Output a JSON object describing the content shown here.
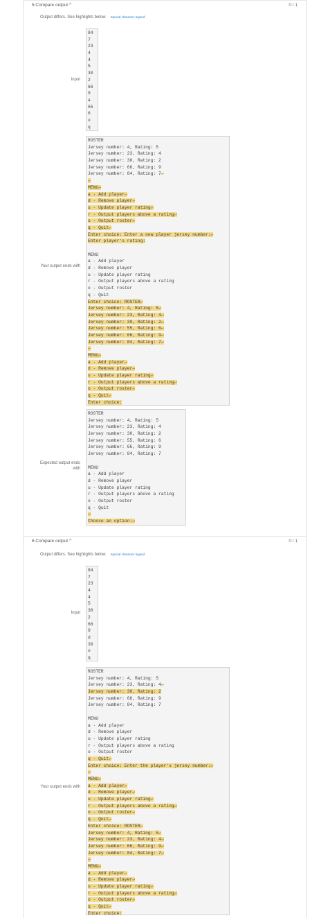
{
  "sections": [
    {
      "title": "5.Compare output",
      "score": "0 / 1",
      "summary": "Output differs. See highlights below.",
      "legend_link": "Special character legend",
      "input_label": "Input",
      "input_lines": [
        "84",
        "7",
        "23",
        "4",
        "4",
        "5",
        "30",
        "2",
        "66",
        "9",
        "a",
        "55",
        "6",
        "o",
        "q"
      ],
      "yours_label": "Your output ends with",
      "yours_lines": [
        {
          "t": "ROSTER"
        },
        {
          "t": "Jersey number: 4, Rating: 5"
        },
        {
          "t": "Jersey number: 23, Rating: 4"
        },
        {
          "t": "Jersey number: 30, Rating: 2"
        },
        {
          "t": "Jersey number: 66, Rating: 9"
        },
        {
          "t": "Jersey number: 84, Rating: 7",
          "nl": true
        },
        {
          "t": "",
          "nl": true,
          "hl": true
        },
        {
          "t": "MENU",
          "nl": true,
          "hl": true
        },
        {
          "t": "a - Add player",
          "nl": true,
          "hl": true
        },
        {
          "t": "d - Remove player",
          "nl": true,
          "hl": true
        },
        {
          "t": "u - Update player rating",
          "nl": true,
          "hl": true
        },
        {
          "t": "r - Output players above a rating",
          "nl": true,
          "hl": true
        },
        {
          "t": "o - Output roster",
          "nl": true,
          "hl": true
        },
        {
          "t": "q - Quit",
          "nl": true,
          "hl": true
        },
        {
          "t": "Enter choice: Enter a new player jersey number:",
          "nl": true,
          "hl": true
        },
        {
          "t": "Enter player's rating:",
          "hl": true
        },
        {
          "t": ""
        },
        {
          "t": "MENU"
        },
        {
          "t": "a - Add player"
        },
        {
          "t": "d - Remove player"
        },
        {
          "t": "u - Update player rating"
        },
        {
          "t": "r - Output players above a rating"
        },
        {
          "t": "o - Output roster"
        },
        {
          "t": "q - Quit"
        },
        {
          "t": "Enter choice: ROSTER",
          "nl": true,
          "hl": true
        },
        {
          "t": "Jersey number: 4, Rating: 5",
          "nl": true,
          "hl": true
        },
        {
          "t": "Jersey number: 23, Rating: 4",
          "nl": true,
          "hl": true
        },
        {
          "t": "Jersey number: 30, Rating: 2",
          "nl": true,
          "hl": true
        },
        {
          "t": "Jersey number: 55, Rating: 6",
          "nl": true,
          "hl": true
        },
        {
          "t": "Jersey number: 66, Rating: 9",
          "nl": true,
          "hl": true
        },
        {
          "t": "Jersey number: 84, Rating: 7",
          "nl": true,
          "hl": true
        },
        {
          "t": "",
          "nl": true,
          "hl": true
        },
        {
          "t": "MENU",
          "nl": true,
          "hl": true
        },
        {
          "t": "a - Add player",
          "nl": true,
          "hl": true
        },
        {
          "t": "d - Remove player",
          "nl": true,
          "hl": true
        },
        {
          "t": "u - Update player rating",
          "nl": true,
          "hl": true
        },
        {
          "t": "r - Output players above a rating",
          "nl": true,
          "hl": true
        },
        {
          "t": "o - Output roster",
          "nl": true,
          "hl": true
        },
        {
          "t": "q - Quit",
          "nl": true,
          "hl": true
        },
        {
          "t": "Enter choice:",
          "hl": true
        }
      ],
      "expected_label": "Expected output ends with",
      "expected_lines": [
        {
          "t": "ROSTER"
        },
        {
          "t": "Jersey number: 4, Rating: 5"
        },
        {
          "t": "Jersey number: 23, Rating: 4"
        },
        {
          "t": "Jersey number: 30, Rating: 2"
        },
        {
          "t": "Jersey number: 55, Rating: 6"
        },
        {
          "t": "Jersey number: 66, Rating: 9"
        },
        {
          "t": "Jersey number: 84, Rating: 7"
        },
        {
          "t": ""
        },
        {
          "t": "MENU"
        },
        {
          "t": "a - Add player"
        },
        {
          "t": "d - Remove player"
        },
        {
          "t": "u - Update player rating"
        },
        {
          "t": "r - Output players above a rating"
        },
        {
          "t": "o - Output roster"
        },
        {
          "t": "q - Quit"
        },
        {
          "t": "",
          "nl": true,
          "hl": true
        },
        {
          "t": "Choose an option:",
          "nl": true,
          "hl": true
        }
      ]
    },
    {
      "title": "6.Compare output",
      "score": "0 / 1",
      "summary": "Output differs. See highlights below.",
      "legend_link": "Special character legend",
      "input_label": "Input",
      "input_lines": [
        "84",
        "7",
        "23",
        "4",
        "4",
        "5",
        "30",
        "2",
        "66",
        "9",
        "d",
        "30",
        "o",
        "q"
      ],
      "yours_label": "Your output ends with",
      "yours_lines": [
        {
          "t": "ROSTER"
        },
        {
          "t": "Jersey number: 4, Rating: 5"
        },
        {
          "t": "Jersey number: 23, Rating: 4",
          "nl": true
        },
        {
          "t": "Jersey number: 30, Rating: 2",
          "hl": true
        },
        {
          "t": "Jersey number: 66, Rating: 9"
        },
        {
          "t": "Jersey number: 84, Rating: 7"
        },
        {
          "t": ""
        },
        {
          "t": "MENU"
        },
        {
          "t": "a - Add player"
        },
        {
          "t": "d - Remove player"
        },
        {
          "t": "u - Update player rating"
        },
        {
          "t": "r - Output players above a rating"
        },
        {
          "t": "o - Output roster"
        },
        {
          "t": "q - Quit",
          "nl": true,
          "hl": true
        },
        {
          "t": "Enter choice: Enter the player's jersey number:",
          "nl": true,
          "hl": true
        },
        {
          "t": "",
          "nl": true,
          "hl": true
        },
        {
          "t": "MENU",
          "nl": true,
          "hl": true
        },
        {
          "t": "a - Add player",
          "nl": true,
          "hl": true
        },
        {
          "t": "d - Remove player",
          "nl": true,
          "hl": true
        },
        {
          "t": "u - Update player rating",
          "nl": true,
          "hl": true
        },
        {
          "t": "r - Output players above a rating",
          "nl": true,
          "hl": true
        },
        {
          "t": "o - Output roster",
          "nl": true,
          "hl": true
        },
        {
          "t": "q - Quit",
          "nl": true,
          "hl": true
        },
        {
          "t": "Enter choice: ROSTER",
          "nl": true,
          "hl": true
        },
        {
          "t": "Jersey number: 4, Rating: 5",
          "nl": true,
          "hl": true
        },
        {
          "t": "Jersey number: 23, Rating: 4",
          "nl": true,
          "hl": true
        },
        {
          "t": "Jersey number: 66, Rating: 9",
          "nl": true,
          "hl": true
        },
        {
          "t": "Jersey number: 84, Rating: 7",
          "nl": true,
          "hl": true
        },
        {
          "t": "",
          "nl": true,
          "hl": true
        },
        {
          "t": "MENU",
          "nl": true,
          "hl": true
        },
        {
          "t": "a - Add player",
          "nl": true,
          "hl": true
        },
        {
          "t": "d - Remove player",
          "nl": true,
          "hl": true
        },
        {
          "t": "u - Update player rating",
          "nl": true,
          "hl": true
        },
        {
          "t": "r - Output players above a rating",
          "nl": true,
          "hl": true
        },
        {
          "t": "o - Output roster",
          "nl": true,
          "hl": true
        },
        {
          "t": "q - Quit",
          "nl": true,
          "hl": true
        },
        {
          "t": "Enter choice:",
          "hl": true
        }
      ]
    }
  ],
  "newline_glyph": "↵"
}
